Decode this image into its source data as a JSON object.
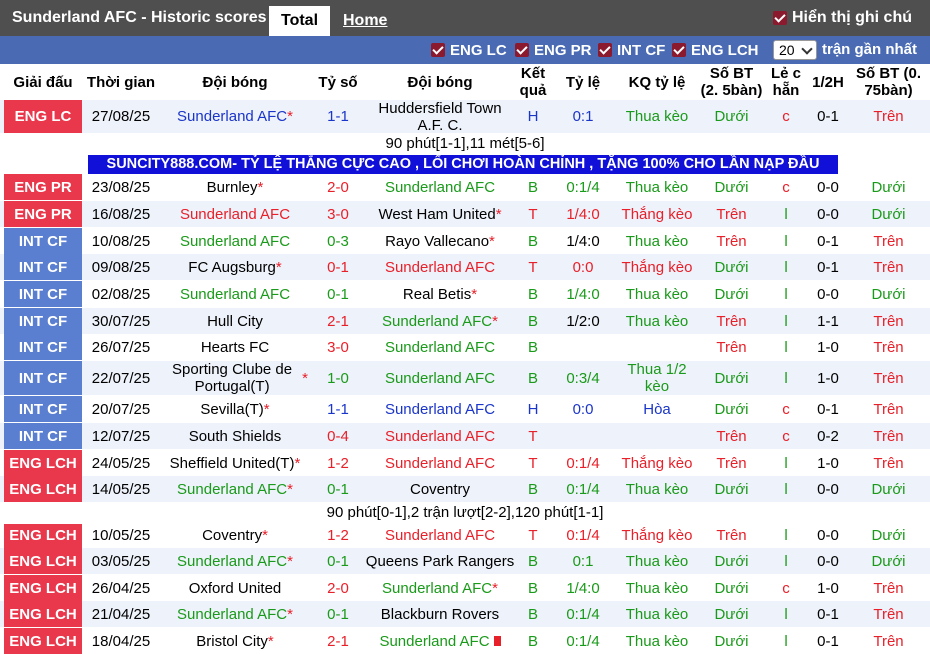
{
  "header": {
    "title": "Sunderland AFC - Historic scores",
    "tab_total": "Total",
    "tab_home": "Home",
    "show_label": "Hiển thị ghi chú"
  },
  "filters": {
    "items": [
      "ENG LC",
      "ENG PR",
      "INT CF",
      "ENG LCH"
    ],
    "count_value": "20",
    "count_suffix": "trận gần nhất"
  },
  "columns": {
    "league": "Giải đấu",
    "time": "Thời gian",
    "home": "Đội bóng",
    "score": "Tỷ số",
    "away": "Đội bóng",
    "result": "Kết quả",
    "odds": "Tỷ lệ",
    "odds_result": "KQ tỷ lệ",
    "goals": "Số BT (2. 5bàn)",
    "odd_even": "Lẻ c hẵn",
    "half": "1/2H",
    "goals_075": "Số BT (0. 75bàn)"
  },
  "banner": "SUNCITY888.COM- TỶ LỆ THẮNG CỰC CAO , LỐI CHƠI HOÀN CHỈNH , TẶNG 100% CHO LẦN NẠP ĐẦU",
  "notes": [
    "90 phút[1-1],11 mét[5-6]",
    "90 phút[0-1],2 trận lượt[2-2],120 phút[1-1]"
  ],
  "rows": [
    {
      "league": "ENG LC",
      "lc": "lg-lc",
      "date": "27/08/25",
      "home": "Sunderland AFC",
      "hs": true,
      "hc": "blue",
      "score": "1-1",
      "sc": "blue",
      "away": "Huddersfield Town A.F. C.",
      "as": false,
      "ac": "",
      "res": "H",
      "rc": "blue",
      "odds": "0:1",
      "oc": "blue",
      "kq": "Thua kèo",
      "kc": "green",
      "bt": "Dưới",
      "bc": "green",
      "oe": "c",
      "ec": "red",
      "half": "0-1",
      "bt2": "Trên",
      "b2c": "red"
    },
    {
      "league": "ENG PR",
      "lc": "lg-pr",
      "date": "23/08/25",
      "home": "Burnley",
      "hs": true,
      "hc": "",
      "score": "2-0",
      "sc": "red",
      "away": "Sunderland AFC",
      "as": false,
      "ac": "green",
      "res": "B",
      "rc": "green",
      "odds": "0:1/4",
      "oc": "green",
      "kq": "Thua kèo",
      "kc": "green",
      "bt": "Dưới",
      "bc": "green",
      "oe": "c",
      "ec": "red",
      "half": "0-0",
      "bt2": "Dưới",
      "b2c": "green"
    },
    {
      "league": "ENG PR",
      "lc": "lg-pr",
      "date": "16/08/25",
      "home": "Sunderland AFC",
      "hs": false,
      "hc": "red",
      "score": "3-0",
      "sc": "red",
      "away": "West Ham United",
      "as": true,
      "ac": "",
      "res": "T",
      "rc": "red",
      "odds": "1/4:0",
      "oc": "red",
      "kq": "Thắng kèo",
      "kc": "red",
      "bt": "Trên",
      "bc": "red",
      "oe": "l",
      "ec": "green",
      "half": "0-0",
      "bt2": "Dưới",
      "b2c": "green"
    },
    {
      "league": "INT CF",
      "lc": "lg-cf",
      "date": "10/08/25",
      "home": "Sunderland AFC",
      "hs": false,
      "hc": "green",
      "score": "0-3",
      "sc": "green",
      "away": "Rayo Vallecano",
      "as": true,
      "ac": "",
      "res": "B",
      "rc": "green",
      "odds": "1/4:0",
      "oc": "",
      "kq": "Thua kèo",
      "kc": "green",
      "bt": "Trên",
      "bc": "red",
      "oe": "l",
      "ec": "green",
      "half": "0-1",
      "bt2": "Trên",
      "b2c": "red"
    },
    {
      "league": "INT CF",
      "lc": "lg-cf",
      "date": "09/08/25",
      "home": "FC Augsburg",
      "hs": true,
      "hc": "",
      "score": "0-1",
      "sc": "red",
      "away": "Sunderland AFC",
      "as": false,
      "ac": "red",
      "res": "T",
      "rc": "red",
      "odds": "0:0",
      "oc": "red",
      "kq": "Thắng kèo",
      "kc": "red",
      "bt": "Dưới",
      "bc": "green",
      "oe": "l",
      "ec": "green",
      "half": "0-1",
      "bt2": "Trên",
      "b2c": "red"
    },
    {
      "league": "INT CF",
      "lc": "lg-cf",
      "date": "02/08/25",
      "home": "Sunderland AFC",
      "hs": false,
      "hc": "green",
      "score": "0-1",
      "sc": "green",
      "away": "Real Betis",
      "as": true,
      "ac": "",
      "res": "B",
      "rc": "green",
      "odds": "1/4:0",
      "oc": "green",
      "kq": "Thua kèo",
      "kc": "green",
      "bt": "Dưới",
      "bc": "green",
      "oe": "l",
      "ec": "green",
      "half": "0-0",
      "bt2": "Dưới",
      "b2c": "green"
    },
    {
      "league": "INT CF",
      "lc": "lg-cf",
      "date": "30/07/25",
      "home": "Hull City",
      "hs": false,
      "hc": "",
      "score": "2-1",
      "sc": "red",
      "away": "Sunderland AFC",
      "as": true,
      "ac": "green",
      "res": "B",
      "rc": "green",
      "odds": "1/2:0",
      "oc": "",
      "kq": "Thua kèo",
      "kc": "green",
      "bt": "Trên",
      "bc": "red",
      "oe": "l",
      "ec": "green",
      "half": "1-1",
      "bt2": "Trên",
      "b2c": "red"
    },
    {
      "league": "INT CF",
      "lc": "lg-cf",
      "date": "26/07/25",
      "home": "Hearts FC",
      "hs": false,
      "hc": "",
      "score": "3-0",
      "sc": "red",
      "away": "Sunderland AFC",
      "as": false,
      "ac": "green",
      "res": "B",
      "rc": "green",
      "odds": "",
      "oc": "",
      "kq": "",
      "kc": "",
      "bt": "Trên",
      "bc": "red",
      "oe": "l",
      "ec": "green",
      "half": "1-0",
      "bt2": "Trên",
      "b2c": "red"
    },
    {
      "league": "INT CF",
      "lc": "lg-cf",
      "date": "22/07/25",
      "home": "Sporting Clube de Portugal(T)",
      "hs": true,
      "hc": "",
      "score": "1-0",
      "sc": "green",
      "away": "Sunderland AFC",
      "as": false,
      "ac": "green",
      "res": "B",
      "rc": "green",
      "odds": "0:3/4",
      "oc": "green",
      "kq": "Thua 1/2 kèo",
      "kc": "green",
      "bt": "Dưới",
      "bc": "green",
      "oe": "l",
      "ec": "green",
      "half": "1-0",
      "bt2": "Trên",
      "b2c": "red",
      "tall": true
    },
    {
      "league": "INT CF",
      "lc": "lg-cf",
      "date": "20/07/25",
      "home": "Sevilla(T)",
      "hs": true,
      "hc": "",
      "score": "1-1",
      "sc": "blue",
      "away": "Sunderland AFC",
      "as": false,
      "ac": "blue",
      "res": "H",
      "rc": "blue",
      "odds": "0:0",
      "oc": "blue",
      "kq": "Hòa",
      "kc": "blue",
      "bt": "Dưới",
      "bc": "green",
      "oe": "c",
      "ec": "red",
      "half": "0-1",
      "bt2": "Trên",
      "b2c": "red"
    },
    {
      "league": "INT CF",
      "lc": "lg-cf",
      "date": "12/07/25",
      "home": "South Shields",
      "hs": false,
      "hc": "",
      "score": "0-4",
      "sc": "red",
      "away": "Sunderland AFC",
      "as": false,
      "ac": "red",
      "res": "T",
      "rc": "red",
      "odds": "",
      "oc": "",
      "kq": "",
      "kc": "",
      "bt": "Trên",
      "bc": "red",
      "oe": "c",
      "ec": "red",
      "half": "0-2",
      "bt2": "Trên",
      "b2c": "red"
    },
    {
      "league": "ENG LCH",
      "lc": "lg-lch",
      "date": "24/05/25",
      "home": "Sheffield United(T)",
      "hs": true,
      "hc": "",
      "score": "1-2",
      "sc": "red",
      "away": "Sunderland AFC",
      "as": false,
      "ac": "red",
      "res": "T",
      "rc": "red",
      "odds": "0:1/4",
      "oc": "red",
      "kq": "Thắng kèo",
      "kc": "red",
      "bt": "Trên",
      "bc": "red",
      "oe": "l",
      "ec": "green",
      "half": "1-0",
      "bt2": "Trên",
      "b2c": "red"
    },
    {
      "league": "ENG LCH",
      "lc": "lg-lch",
      "date": "14/05/25",
      "home": "Sunderland AFC",
      "hs": true,
      "hc": "green",
      "score": "0-1",
      "sc": "green",
      "away": "Coventry",
      "as": false,
      "ac": "",
      "res": "B",
      "rc": "green",
      "odds": "0:1/4",
      "oc": "green",
      "kq": "Thua kèo",
      "kc": "green",
      "bt": "Dưới",
      "bc": "green",
      "oe": "l",
      "ec": "green",
      "half": "0-0",
      "bt2": "Dưới",
      "b2c": "green"
    },
    {
      "league": "ENG LCH",
      "lc": "lg-lch",
      "date": "10/05/25",
      "home": "Coventry",
      "hs": true,
      "hc": "",
      "score": "1-2",
      "sc": "red",
      "away": "Sunderland AFC",
      "as": false,
      "ac": "red",
      "res": "T",
      "rc": "red",
      "odds": "0:1/4",
      "oc": "red",
      "kq": "Thắng kèo",
      "kc": "red",
      "bt": "Trên",
      "bc": "red",
      "oe": "l",
      "ec": "green",
      "half": "0-0",
      "bt2": "Dưới",
      "b2c": "green"
    },
    {
      "league": "ENG LCH",
      "lc": "lg-lch",
      "date": "03/05/25",
      "home": "Sunderland AFC",
      "hs": true,
      "hc": "green",
      "score": "0-1",
      "sc": "green",
      "away": "Queens Park Rangers",
      "as": false,
      "ac": "",
      "res": "B",
      "rc": "green",
      "odds": "0:1",
      "oc": "green",
      "kq": "Thua kèo",
      "kc": "green",
      "bt": "Dưới",
      "bc": "green",
      "oe": "l",
      "ec": "green",
      "half": "0-0",
      "bt2": "Dưới",
      "b2c": "green"
    },
    {
      "league": "ENG LCH",
      "lc": "lg-lch",
      "date": "26/04/25",
      "home": "Oxford United",
      "hs": false,
      "hc": "",
      "score": "2-0",
      "sc": "red",
      "away": "Sunderland AFC",
      "as": true,
      "ac": "green",
      "res": "B",
      "rc": "green",
      "odds": "1/4:0",
      "oc": "green",
      "kq": "Thua kèo",
      "kc": "green",
      "bt": "Dưới",
      "bc": "green",
      "oe": "c",
      "ec": "red",
      "half": "1-0",
      "bt2": "Trên",
      "b2c": "red"
    },
    {
      "league": "ENG LCH",
      "lc": "lg-lch",
      "date": "21/04/25",
      "home": "Sunderland AFC",
      "hs": true,
      "hc": "green",
      "score": "0-1",
      "sc": "green",
      "away": "Blackburn Rovers",
      "as": false,
      "ac": "",
      "res": "B",
      "rc": "green",
      "odds": "0:1/4",
      "oc": "green",
      "kq": "Thua kèo",
      "kc": "green",
      "bt": "Dưới",
      "bc": "green",
      "oe": "l",
      "ec": "green",
      "half": "0-1",
      "bt2": "Trên",
      "b2c": "red"
    },
    {
      "league": "ENG LCH",
      "lc": "lg-lch",
      "date": "18/04/25",
      "home": "Bristol City",
      "hs": true,
      "hc": "",
      "score": "2-1",
      "sc": "red",
      "away": "Sunderland AFC",
      "as": false,
      "ac": "green",
      "res": "B",
      "rc": "green",
      "odds": "0:1/4",
      "oc": "green",
      "kq": "Thua kèo",
      "kc": "green",
      "bt": "Dưới",
      "bc": "green",
      "oe": "l",
      "ec": "green",
      "half": "0-1",
      "bt2": "Trên",
      "b2c": "red",
      "card": true
    }
  ]
}
